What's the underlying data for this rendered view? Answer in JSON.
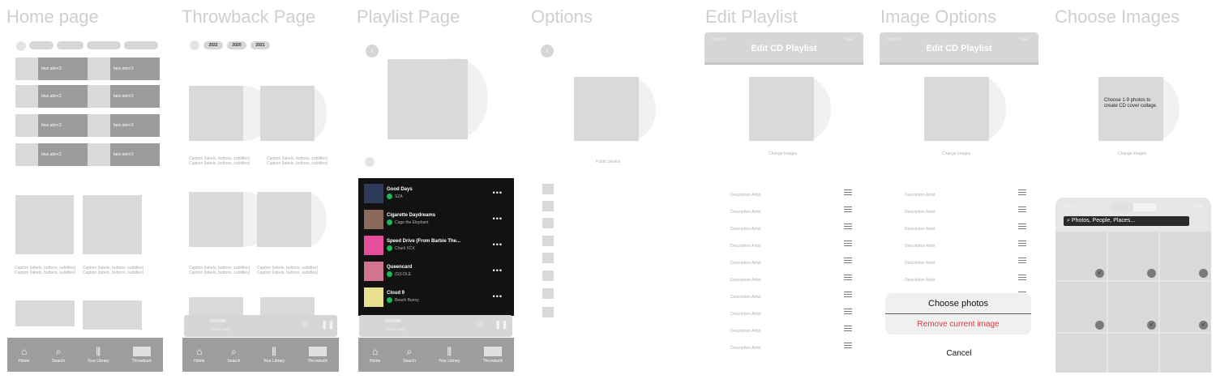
{
  "titles": {
    "home": "Home page",
    "throwback": "Throwback Page",
    "playlist": "Playlist Page",
    "options": "Options",
    "edit": "Edit Playlist",
    "image_options": "Image Options",
    "choose": "Choose Images"
  },
  "home": {
    "tile_label": "favs atm<3",
    "caption": "Caption (labels, buttons, subtitles)"
  },
  "throwback": {
    "chips": [
      "2022",
      "2020",
      "2021"
    ],
    "caption": "Caption (labels, buttons, subtitles)"
  },
  "nav": {
    "home": "Home",
    "search": "Search",
    "library": "Your Library",
    "throwback": "Throwback"
  },
  "player": {
    "song": "Helmet",
    "artist": "Steve Lacy"
  },
  "playlist": {
    "tracks": [
      {
        "name": "Good Days",
        "artist": "SZA",
        "color": "#2e3b58"
      },
      {
        "name": "Cigarette Daydreams",
        "artist": "Cage the Elephant",
        "color": "#8a6a5a"
      },
      {
        "name": "Speed Drive (From Barbie The...",
        "artist": "Charli XCX",
        "color": "#e64e9c"
      },
      {
        "name": "Queencard",
        "artist": "(G)I-DLE",
        "color": "#d0748f"
      },
      {
        "name": "Cloud 9",
        "artist": "Beach Bunny",
        "color": "#e9e08f"
      }
    ]
  },
  "options": {
    "public_label": "Public playlist"
  },
  "edit": {
    "cancel": "Cancel",
    "save": "Save",
    "title": "Edit CD Playlist",
    "change_images": "Change Images",
    "row_label": "Description Artist"
  },
  "image_options": {
    "choose_photos": "Choose photos",
    "remove_image": "Remove current image",
    "cancel": "Cancel",
    "remove_color": "#e0393e"
  },
  "choose": {
    "prompt": "Choose 1-9 photos to create CD cover collage",
    "change_images": "Change Images",
    "cancel": "Cancel",
    "done": "Done",
    "search_placeholder": "Photos, People, Places..."
  }
}
